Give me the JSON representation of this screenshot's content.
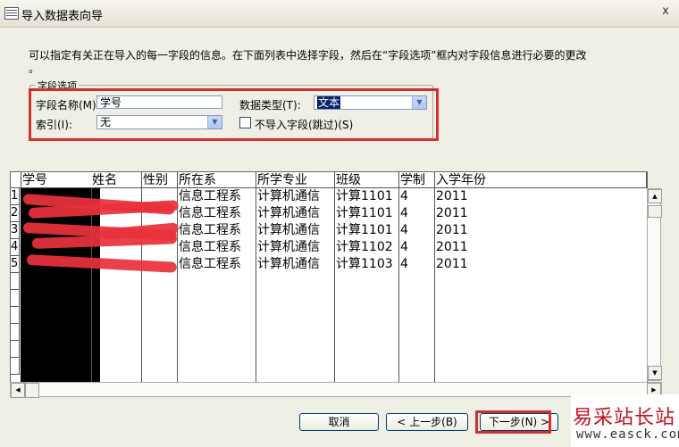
{
  "window": {
    "title": "导入数据表向导",
    "close": "x"
  },
  "description": "可以指定有关正在导入的每一字段的信息。在下面列表中选择字段，然后在“字段选项”框内对字段信息进行必要的更改",
  "description_tail": "。",
  "field_options": {
    "group_label": "字段选项",
    "field_name_label": "字段名称(M)",
    "field_name_value": "学号",
    "data_type_label": "数据类型(T):",
    "data_type_value": "文本",
    "index_label": "索引(I):",
    "index_value": "无",
    "skip_label": "不导入字段(跳过)(S)"
  },
  "table": {
    "columns": [
      "学号",
      "姓名",
      "性别",
      "所在系",
      "所学专业",
      "班级",
      "学制",
      "入学年份"
    ],
    "row_numbers": [
      "1",
      "2",
      "3",
      "4",
      "5"
    ],
    "rows": [
      [
        "信息工程系",
        "计算机通信",
        "计算1101",
        "4",
        "2011"
      ],
      [
        "信息工程系",
        "计算机通信",
        "计算1101",
        "4",
        "2011"
      ],
      [
        "信息工程系",
        "计算机通信",
        "计算1101",
        "4",
        "2011"
      ],
      [
        "信息工程系",
        "计算机通信",
        "计算1102",
        "4",
        "2011"
      ],
      [
        "信息工程系",
        "计算机通信",
        "计算1103",
        "4",
        "2011"
      ]
    ]
  },
  "buttons": {
    "cancel": "取消",
    "back": "< 上一步(B)",
    "next": "下一步(N) >"
  },
  "watermark": {
    "line1": "易采站长站",
    "line2": "www.easck.com"
  },
  "colors": {
    "highlight": "#d23030",
    "accent": "#0a246a"
  }
}
